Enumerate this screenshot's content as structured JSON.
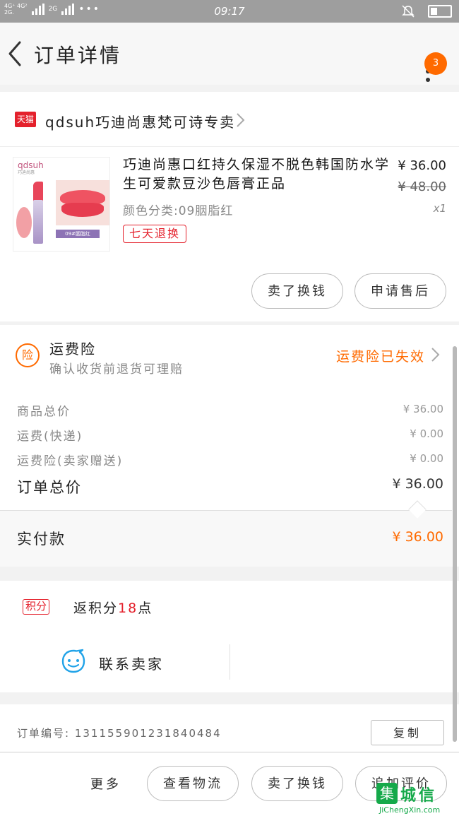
{
  "status_bar": {
    "network_top": "4G⁺ 4G²",
    "network_bottom": "2G.",
    "network_extra": "2G",
    "dots": "•••",
    "time": "09:17"
  },
  "header": {
    "title": "订单详情",
    "badge_count": "3"
  },
  "shop": {
    "platform_badge": "天猫",
    "name": "qdsuh巧迪尚惠梵可诗专卖"
  },
  "product": {
    "title": "巧迪尚惠口红持久保湿不脱色韩国防水学生可爱款豆沙色唇膏正品",
    "price": "¥ 36.00",
    "original_price": "¥ 48.00",
    "quantity": "x1",
    "spec": "颜色分类:09胭脂红",
    "return_policy": "七天退换",
    "image": {
      "brand": "qdsuh",
      "brand_sub": "巧迪尚惠",
      "shade": "09#胭脂红"
    }
  },
  "product_actions": {
    "resell": "卖了换钱",
    "after_sale": "申请售后"
  },
  "insurance": {
    "icon_text": "险",
    "title": "运费险",
    "subtitle": "确认收货前退货可理赔",
    "status": "运费险已失效"
  },
  "summary": {
    "rows": [
      {
        "label": "商品总价",
        "value": "¥ 36.00"
      },
      {
        "label": "运费(快递)",
        "value": "¥ 0.00"
      },
      {
        "label": "运费险(卖家赠送)",
        "value": "¥ 0.00"
      }
    ],
    "total_label": "订单总价",
    "total_value": "¥ 36.00",
    "paid_label": "实付款",
    "paid_value": "¥ 36.00"
  },
  "points": {
    "badge": "积分",
    "prefix": "返积分",
    "count": "18",
    "suffix": "点"
  },
  "contact": {
    "label": "联系卖家"
  },
  "order": {
    "label": "订单编号:",
    "number": "1311559012318404​84",
    "copy": "复制"
  },
  "bottom_bar": {
    "more": "更多",
    "logistics": "查看物流",
    "resell": "卖了换钱",
    "review": "追加评价"
  },
  "watermark": {
    "box": "集",
    "cn": "城信",
    "en": "JiChengXin.com"
  },
  "colors": {
    "accent_orange": "#ff6a00",
    "tmall_red": "#e4212c",
    "status_gray": "#9e9e9e"
  }
}
